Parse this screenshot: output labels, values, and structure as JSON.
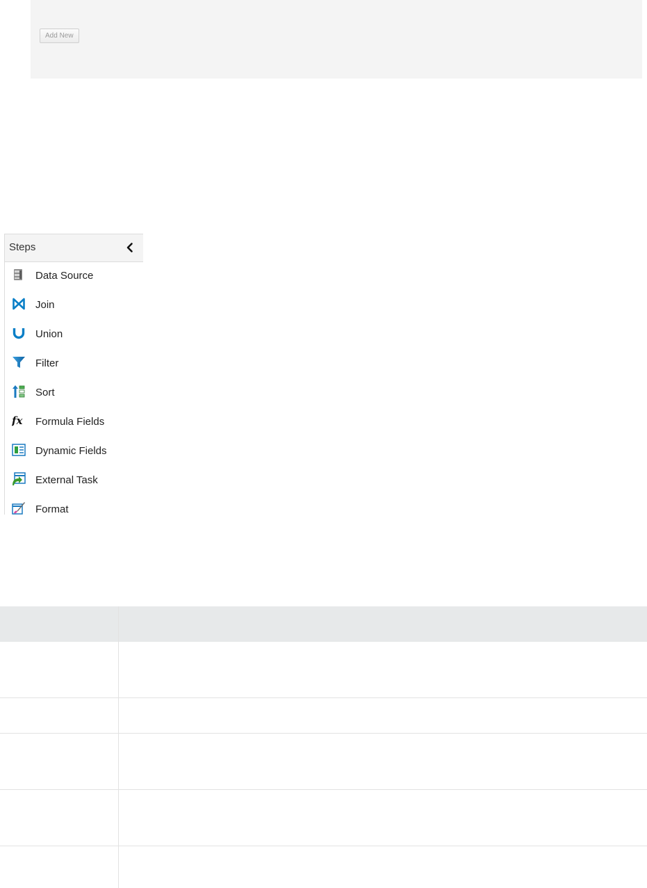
{
  "toolbar": {
    "add_new_label": "Add New"
  },
  "steps": {
    "title": "Steps",
    "collapse_icon": "chevron-left-icon",
    "items": [
      {
        "label": "Data Source",
        "icon": "database-icon"
      },
      {
        "label": "Join",
        "icon": "join-icon"
      },
      {
        "label": "Union",
        "icon": "union-icon"
      },
      {
        "label": "Filter",
        "icon": "filter-icon"
      },
      {
        "label": "Sort",
        "icon": "sort-icon"
      },
      {
        "label": "Formula Fields",
        "icon": "formula-icon"
      },
      {
        "label": "Dynamic Fields",
        "icon": "dynamic-fields-icon"
      },
      {
        "label": "External Task",
        "icon": "external-task-icon"
      },
      {
        "label": "Format",
        "icon": "format-icon"
      }
    ]
  },
  "colors": {
    "panel_bg": "#f4f4f4",
    "table_header_bg": "#e7e9ea",
    "accent_blue": "#0a7fc7",
    "border": "#dcdcdc"
  }
}
